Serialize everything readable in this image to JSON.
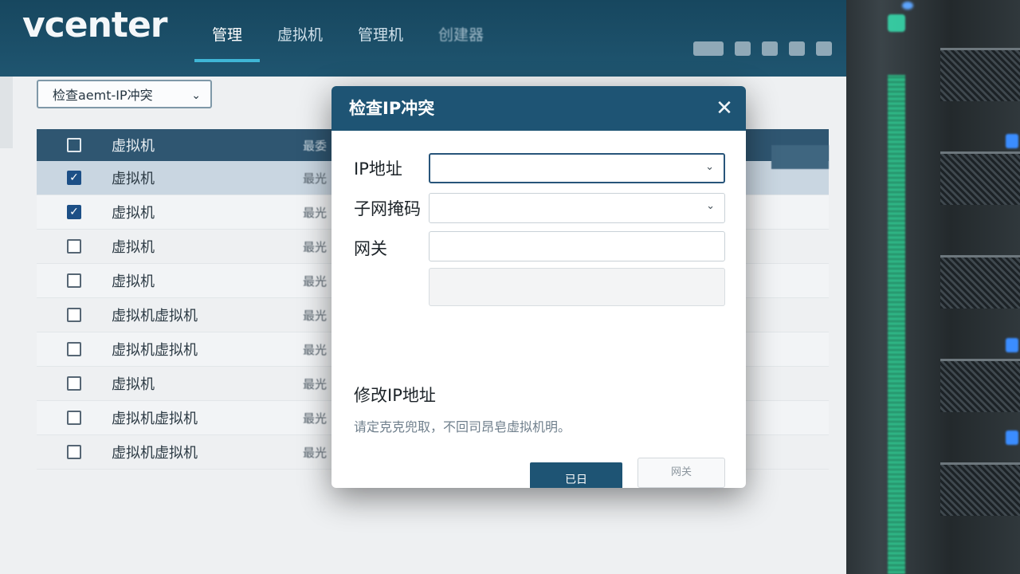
{
  "app": {
    "logo": "vcenter"
  },
  "nav": {
    "items": [
      {
        "label": "管理",
        "active": true
      },
      {
        "label": "虚拟机",
        "active": false
      },
      {
        "label": "管理机",
        "active": false
      },
      {
        "label": "创建器",
        "active": false
      }
    ]
  },
  "toolbar": {
    "icons": [
      "badge-icon",
      "document-icon",
      "gear-icon",
      "bell-icon",
      "chevron-down-icon"
    ]
  },
  "filter": {
    "selected": "检查aemt-IP冲突"
  },
  "table": {
    "header": {
      "name": "虚拟机",
      "col2": "最委"
    },
    "rows": [
      {
        "name": "虚拟机",
        "col2": "最光",
        "checked": true
      },
      {
        "name": "虚拟机",
        "col2": "最光",
        "checked": true
      },
      {
        "name": "虚拟机",
        "col2": "最光",
        "checked": false
      },
      {
        "name": "虚拟机",
        "col2": "最光",
        "checked": false
      },
      {
        "name": "虚拟机虚拟机",
        "col2": "最光",
        "checked": false
      },
      {
        "name": "虚拟机虚拟机",
        "col2": "最光",
        "checked": false
      },
      {
        "name": "虚拟机",
        "col2": "最光",
        "checked": false
      },
      {
        "name": "虚拟机虚拟机",
        "col2": "最光",
        "checked": false
      },
      {
        "name": "虚拟机虚拟机",
        "col2": "最光",
        "checked": false
      }
    ]
  },
  "dialog": {
    "title": "检查IP冲突",
    "fields": {
      "ip_label": "IP地址",
      "ip_value": "",
      "mask_label": "子网掩码",
      "mask_value": "",
      "gateway_label": "网关",
      "gateway_value": "",
      "extra_value": ""
    },
    "section_title": "修改IP地址",
    "section_desc": "请定克克兜取，不回司昂皂虚拟机明。",
    "primary_button": "已日",
    "secondary_button": "网关"
  },
  "colors": {
    "header_bg": "#1e5474",
    "accent": "#3fb6d6",
    "checkbox_checked": "#1c4f86",
    "rack_led_green": "#35e3a2"
  }
}
